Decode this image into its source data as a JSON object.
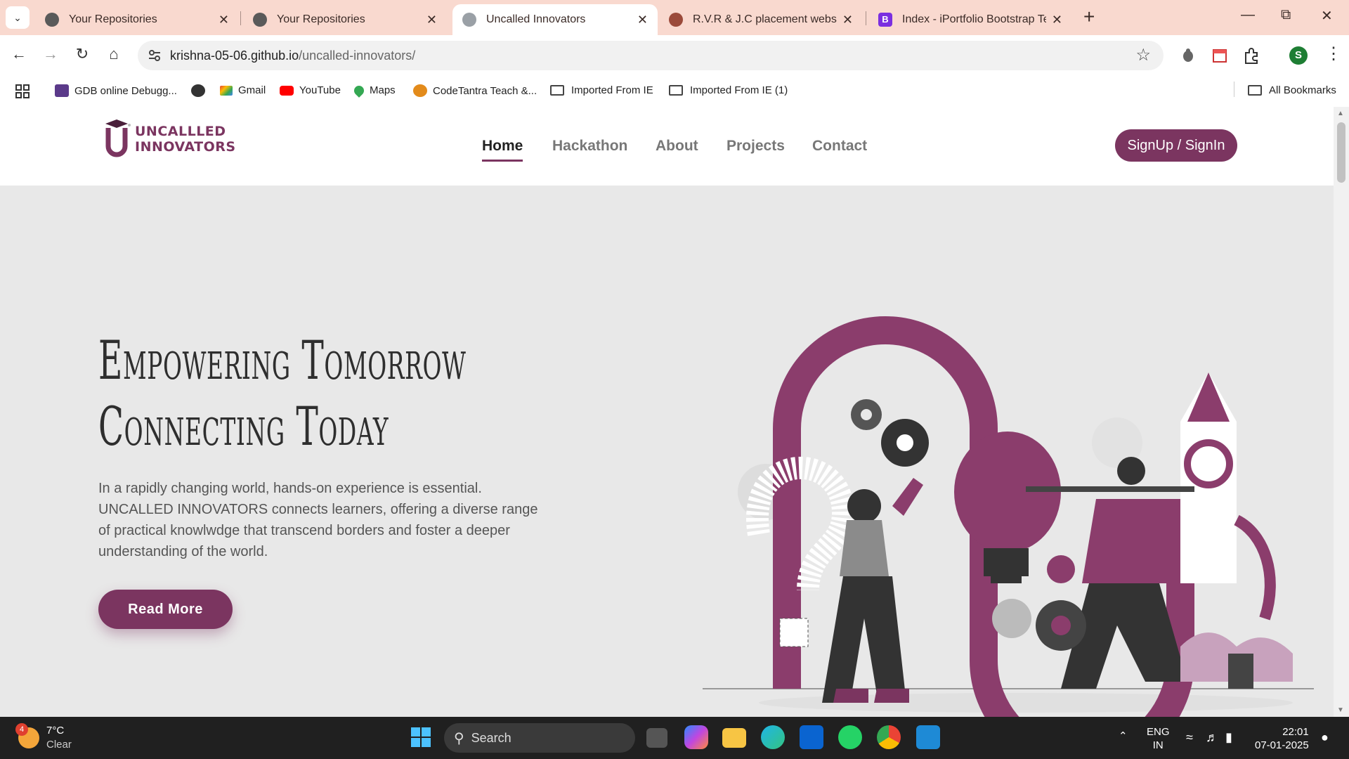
{
  "browser": {
    "tabs": [
      {
        "title": "Your Repositories",
        "favicon": "github-icon",
        "active": false
      },
      {
        "title": "Your Repositories",
        "favicon": "github-icon",
        "active": false
      },
      {
        "title": "Uncalled Innovators",
        "favicon": "globe-icon",
        "active": true
      },
      {
        "title": "R.V.R & J.C placement website",
        "favicon": "site-icon",
        "active": false
      },
      {
        "title": "Index - iPortfolio Bootstrap Tem",
        "favicon": "bootstrap-icon",
        "active": false
      }
    ],
    "url_host": "krishna-05-06.github.io",
    "url_path": "/uncalled-innovators/",
    "profile_initial": "S",
    "bookmarks": [
      {
        "label": "GDB online Debugg...",
        "icon": "gdb-icon"
      },
      {
        "label": "",
        "icon": "globe-icon"
      },
      {
        "label": "Gmail",
        "icon": "gmail-icon"
      },
      {
        "label": "YouTube",
        "icon": "youtube-icon"
      },
      {
        "label": "Maps",
        "icon": "maps-icon"
      },
      {
        "label": "CodeTantra Teach &...",
        "icon": "codetantra-icon"
      },
      {
        "label": "Imported From IE",
        "icon": "folder-icon"
      },
      {
        "label": "Imported From IE (1)",
        "icon": "folder-icon"
      }
    ],
    "all_bookmarks": "All Bookmarks"
  },
  "site": {
    "logo_line1": "UNCALLLED",
    "logo_line2": "INNOVATORS",
    "nav": [
      "Home",
      "Hackathon",
      "About",
      "Projects",
      "Contact"
    ],
    "signin_label": "SignUp / SignIn",
    "hero_title_line1": "Empowering Tomorrow",
    "hero_title_line2": "Connecting Today",
    "hero_description": "In a rapidly changing world, hands-on experience is essential. UNCALLED INNOVATORS connects learners, offering a diverse range of practical knowlwdge that transcend borders and foster a deeper understanding of the world.",
    "read_more": "Read More",
    "brand_color": "#7b3560"
  },
  "taskbar": {
    "weather_badge": "4",
    "temperature": "7°C",
    "condition": "Clear",
    "search_label": "Search",
    "lang_line1": "ENG",
    "lang_line2": "IN",
    "time": "22:01",
    "date": "07-01-2025"
  }
}
